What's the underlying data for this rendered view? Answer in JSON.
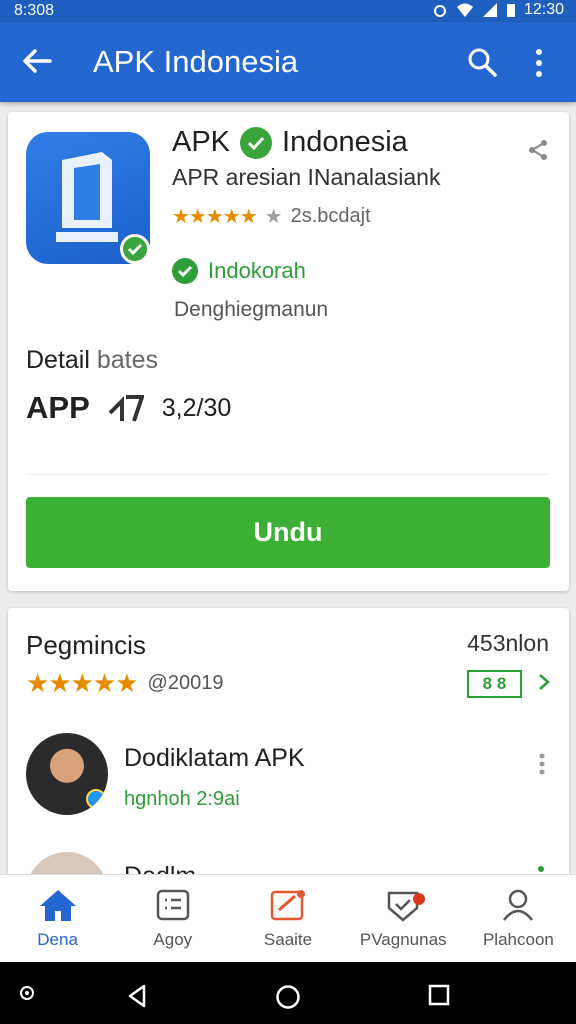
{
  "status_bar": {
    "time_left": "8:308",
    "time_right": "12:30"
  },
  "app_bar": {
    "title": "APK Indonesia"
  },
  "app": {
    "name_part1": "APK",
    "name_part2": "Indonesia",
    "subtitle": "APR aresian INanalasiank",
    "rating_text": "2s.bcdajt",
    "status": "Indokorah",
    "developer": "Denghiegmanun",
    "detail_label": "Detail",
    "detail_value": "bates",
    "app_label": "APP",
    "app_count": "3,2/30",
    "download_label": "Undu"
  },
  "reviews": {
    "title": "Pegmincis",
    "count": "453nlon",
    "date": "@20019",
    "badge": "8 8",
    "items": [
      {
        "name": "Dodiklatam APK",
        "meta": "hgnhoh 2:9ai"
      },
      {
        "name": "Dedlm..."
      }
    ]
  },
  "bottom_nav": [
    {
      "label": "Dena",
      "icon": "home-icon"
    },
    {
      "label": "Agoy",
      "icon": "list-icon"
    },
    {
      "label": "Saaite",
      "icon": "edit-icon"
    },
    {
      "label": "PVagnunas",
      "icon": "shield-icon"
    },
    {
      "label": "Plahcoon",
      "icon": "person-icon"
    }
  ],
  "colors": {
    "app_bar": "#2467d0",
    "accent_green": "#3caf35",
    "star": "#e68a00",
    "active_nav": "#2467d0"
  }
}
